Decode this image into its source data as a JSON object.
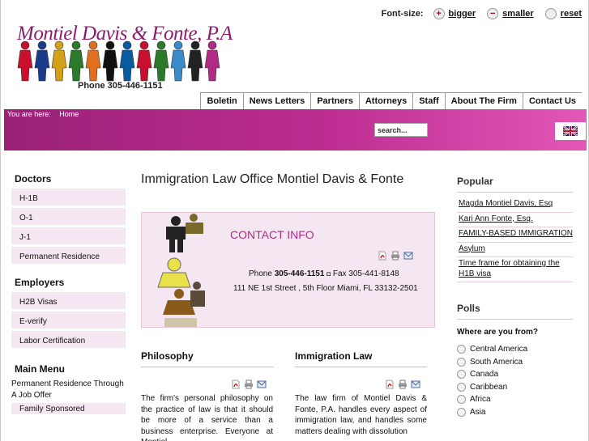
{
  "brand": {
    "logo_text": "Montiel Davis & Fonte, P.A",
    "phone": "Phone 305-446-1151"
  },
  "font_size": {
    "label": "Font-size:",
    "bigger": "bigger",
    "smaller": "smaller",
    "reset": "reset"
  },
  "nav": [
    "Boletin",
    "News Letters",
    "Partners",
    "Attorneys",
    "Staff",
    "About The Firm",
    "Contact Us"
  ],
  "breadcrumb": {
    "prefix": "You are here:",
    "current": "Home"
  },
  "search": {
    "placeholder": "search..."
  },
  "left": {
    "doctors_title": "Doctors",
    "doctors": [
      "H-1B",
      "O-1",
      "J-1",
      "Permanent Residence"
    ],
    "employers_title": "Employers",
    "employers": [
      "H2B Visas",
      "E-verify",
      "Labor Certification"
    ],
    "main_menu_title": "Main Menu",
    "main_menu": [
      "Permanent Residence Through A Job Offer",
      "Family Sponsored"
    ]
  },
  "main": {
    "title": "Immigration Law Office Montiel Davis & Fonte",
    "contact_title": "CONTACT INFO",
    "phone_label": "Phone",
    "phone": "305-446-1151",
    "fax": "Fax 305-441-8148",
    "address": "111 NE 1st Street , 5th Floor Miami, FL 33132-2501",
    "philosophy_title": "Philosophy",
    "philosophy_text": "The firm's personal philosophy on the practice of law is that it should be more of a service than a business enterprise. Everyone at Montiel",
    "immigration_title": "Immigration Law",
    "immigration_text": "The law firm of Montiel Davis & Fonte, P.A. handles every aspect of immigration law, and handles some matters dealing with dissolution"
  },
  "right": {
    "popular_title": "Popular",
    "popular": [
      "Magda Montiel Davis, Esq",
      "Kari Ann Fonte, Esq.",
      "FAMILY-BASED IMMIGRATION",
      "Asylum",
      "Time frame for obtaining the H1B visa"
    ],
    "polls_title": "Polls",
    "question": "Where are you from?",
    "options": [
      "Central America",
      "South America",
      "Canada",
      "Caribbean",
      "Africa",
      "Asia"
    ]
  },
  "colors": {
    "accent": "#bd2d91",
    "accent_dark": "#9a2177",
    "panel": "#f5e7f1"
  },
  "icons": [
    "pdf-icon",
    "print-icon",
    "email-icon",
    "uk-flag-icon"
  ]
}
